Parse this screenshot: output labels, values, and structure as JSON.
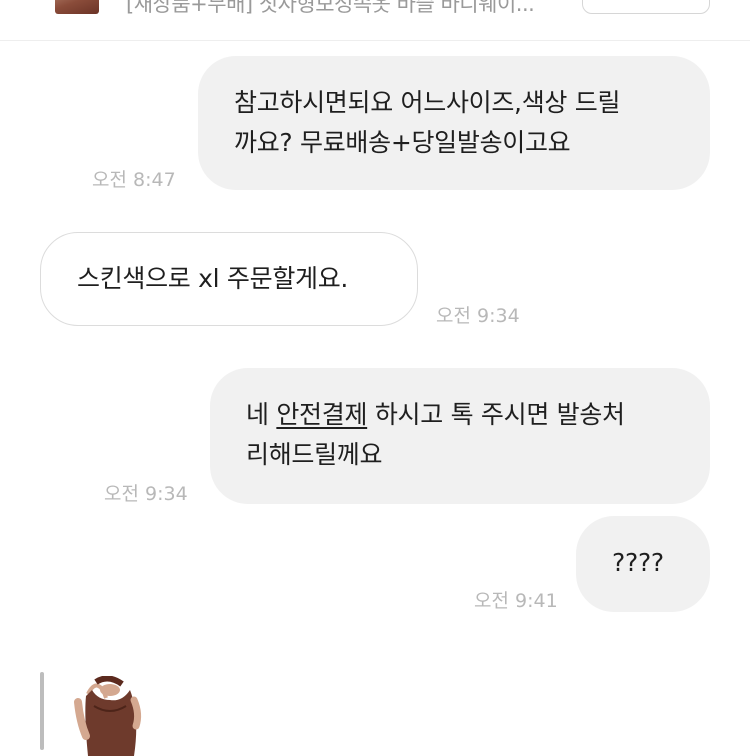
{
  "header": {
    "product_title": "[새상품+무배] 짓자형보정속옷 바슬 바디웨이..."
  },
  "messages": [
    {
      "direction": "outgoing",
      "lines": [
        "참고하시면되요 어느사이즈,색상 드릴",
        "까요? 무료배송+당일발송이고요"
      ],
      "time": "오전 8:47"
    },
    {
      "direction": "incoming",
      "lines": [
        "스킨색으로 xl 주문할게요."
      ],
      "time": "오전 9:34"
    },
    {
      "direction": "outgoing",
      "line1_before": "네 ",
      "line1_link": "안전결제",
      "line1_after": " 하시고 톡 주시면 발송처",
      "line2": "리해드릴께요",
      "time": "오전 9:34"
    },
    {
      "direction": "outgoing",
      "lines": [
        "????"
      ],
      "time": "오전 9:41"
    }
  ],
  "colors": {
    "outgoing_bubble": "#f1f1f1",
    "incoming_bubble": "#ffffff",
    "timestamp": "#b8b8b8"
  }
}
